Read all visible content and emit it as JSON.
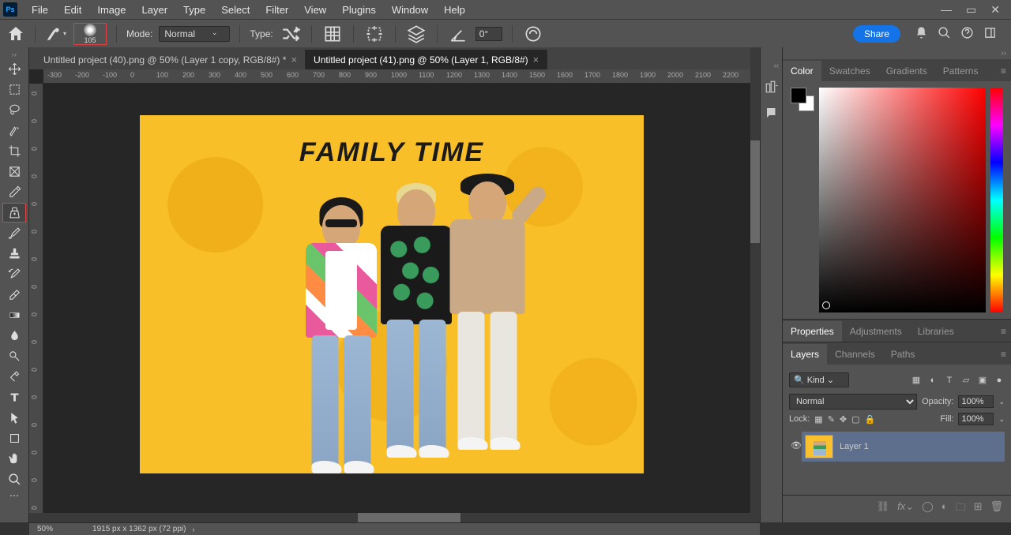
{
  "menu": {
    "items": [
      "File",
      "Edit",
      "Image",
      "Layer",
      "Type",
      "Select",
      "Filter",
      "View",
      "Plugins",
      "Window",
      "Help"
    ]
  },
  "options": {
    "brush_size": "105",
    "mode_label": "Mode:",
    "mode_value": "Normal",
    "type_label": "Type:",
    "angle": "0°",
    "share": "Share"
  },
  "tabs": [
    {
      "label": "Untitled project (40).png @ 50% (Layer 1 copy, RGB/8#) *",
      "active": false
    },
    {
      "label": "Untitled project (41).png @ 50% (Layer 1, RGB/8#)",
      "active": true
    }
  ],
  "canvas": {
    "title": "FAMILY TIME"
  },
  "ruler_h": [
    "-300",
    "-200",
    "-100",
    "0",
    "100",
    "200",
    "300",
    "400",
    "500",
    "600",
    "700",
    "800",
    "900",
    "1000",
    "1100",
    "1200",
    "1300",
    "1400",
    "1500",
    "1600",
    "1700",
    "1800",
    "1900",
    "2000",
    "2100",
    "2200"
  ],
  "ruler_v": [
    "0",
    "0",
    "0",
    "0",
    "0",
    "0",
    "0",
    "0",
    "0",
    "0",
    "0",
    "0",
    "0",
    "0",
    "0",
    "0"
  ],
  "color_panel": {
    "tabs": [
      "Color",
      "Swatches",
      "Gradients",
      "Patterns"
    ]
  },
  "props_panel": {
    "tabs": [
      "Properties",
      "Adjustments",
      "Libraries"
    ]
  },
  "layers_panel": {
    "tabs": [
      "Layers",
      "Channels",
      "Paths"
    ],
    "kind_search": "Kind",
    "blend_mode": "Normal",
    "opacity_label": "Opacity:",
    "opacity_value": "100%",
    "lock_label": "Lock:",
    "fill_label": "Fill:",
    "fill_value": "100%",
    "layer_name": "Layer 1"
  },
  "status": {
    "zoom": "50%",
    "doc_info": "1915 px x 1362 px (72 ppi)"
  }
}
